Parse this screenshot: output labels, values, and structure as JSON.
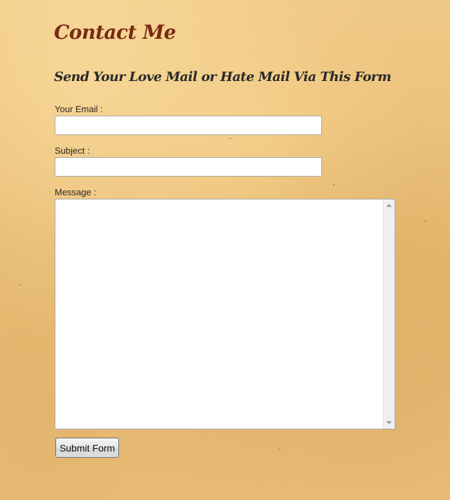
{
  "page": {
    "title": "Contact Me",
    "form_heading": "Send Your Love Mail or Hate Mail Via This Form"
  },
  "form": {
    "email_label": "Your Email :",
    "email_value": "",
    "subject_label": "Subject :",
    "subject_value": "",
    "message_label": "Message :",
    "message_value": "",
    "submit_label": "Submit Form"
  },
  "colors": {
    "title": "#7a2a12",
    "heading": "#2a2a2a",
    "background": "#e9bd74"
  },
  "icons": {
    "scroll_up": "scroll-up-arrow-icon",
    "scroll_down": "scroll-down-arrow-icon"
  }
}
